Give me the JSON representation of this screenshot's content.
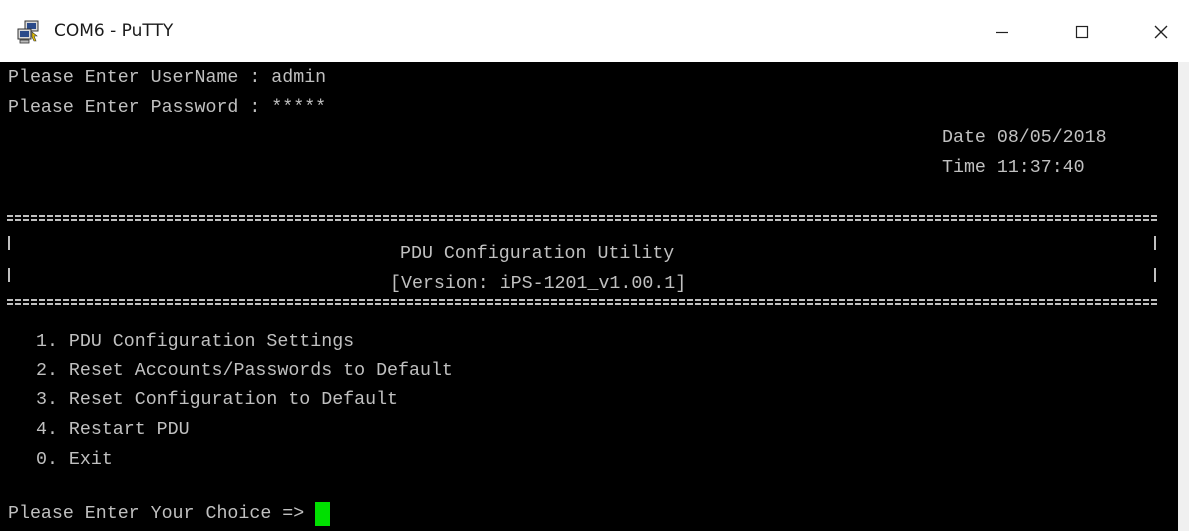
{
  "window": {
    "title": "COM6 - PuTTY",
    "icon": "putty-computers-icon",
    "controls": {
      "minimize_icon": "minimize-icon",
      "maximize_icon": "maximize-icon",
      "close_icon": "close-icon"
    }
  },
  "terminal": {
    "colors": {
      "background": "#000000",
      "foreground": "#c0c0c0",
      "cursor": "#00e000"
    },
    "login": {
      "username_line": "Please Enter UserName : admin",
      "password_line": "Please Enter Password : *****"
    },
    "datetime": {
      "date_line": "Date 08/05/2018",
      "time_line": "Time 11:37:40"
    },
    "banner": {
      "border_line": "+=========================================================================+",
      "title": "PDU Configuration Utility",
      "version": "[Version: iPS-1201_v1.00.1]"
    },
    "menu": {
      "items": [
        "1. PDU Configuration Settings",
        "2. Reset Accounts/Passwords to Default",
        "3. Reset Configuration to Default",
        "4. Restart PDU",
        "0. Exit"
      ]
    },
    "prompt": "Please Enter Your Choice => "
  }
}
